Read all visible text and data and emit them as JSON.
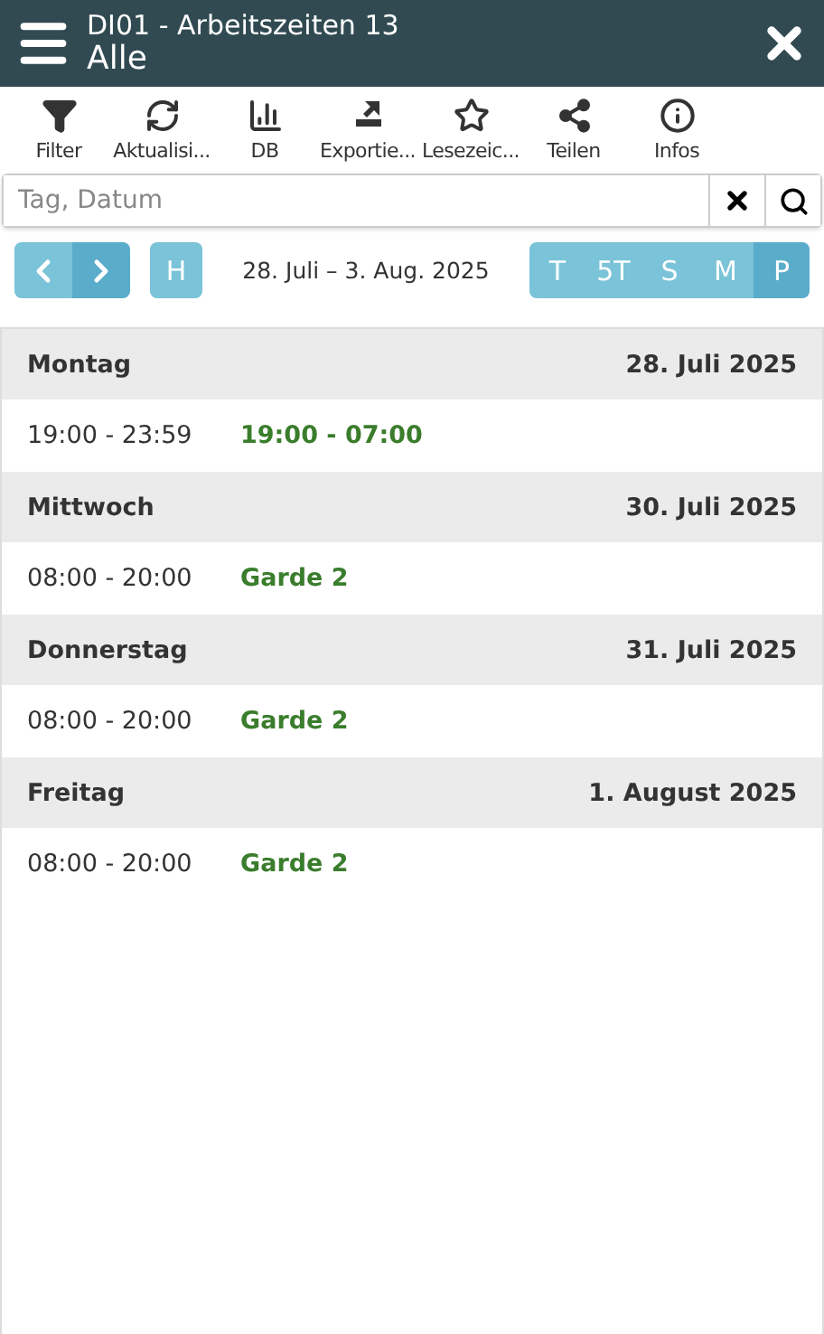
{
  "header": {
    "title": "DI01 - Arbeitszeiten 13",
    "subtitle": "Alle"
  },
  "toolbar": [
    {
      "kind": "filter",
      "label": "Filter"
    },
    {
      "kind": "refresh",
      "label": "Aktualisi..."
    },
    {
      "kind": "chart",
      "label": "DB"
    },
    {
      "kind": "export",
      "label": "Exportie..."
    },
    {
      "kind": "star",
      "label": "Lesezeic..."
    },
    {
      "kind": "share",
      "label": "Teilen"
    },
    {
      "kind": "info",
      "label": "Infos"
    }
  ],
  "search": {
    "placeholder": "Tag, Datum"
  },
  "nav": {
    "today": "H",
    "range": "28. Juli – 3. Aug. 2025",
    "views": [
      {
        "label": "T",
        "selected": false
      },
      {
        "label": "5T",
        "selected": false
      },
      {
        "label": "S",
        "selected": false
      },
      {
        "label": "M",
        "selected": false
      },
      {
        "label": "P",
        "selected": true
      }
    ]
  },
  "days": [
    {
      "day": "Montag",
      "date": "28. Juli 2025",
      "entries": [
        {
          "time": "19:00 - 23:59",
          "shift": "19:00 - 07:00"
        }
      ]
    },
    {
      "day": "Mittwoch",
      "date": "30. Juli 2025",
      "entries": [
        {
          "time": "08:00 - 20:00",
          "shift": "Garde 2"
        }
      ]
    },
    {
      "day": "Donnerstag",
      "date": "31. Juli 2025",
      "entries": [
        {
          "time": "08:00 - 20:00",
          "shift": "Garde 2"
        }
      ]
    },
    {
      "day": "Freitag",
      "date": "1. August 2025",
      "entries": [
        {
          "time": "08:00 - 20:00",
          "shift": "Garde 2"
        }
      ]
    }
  ]
}
